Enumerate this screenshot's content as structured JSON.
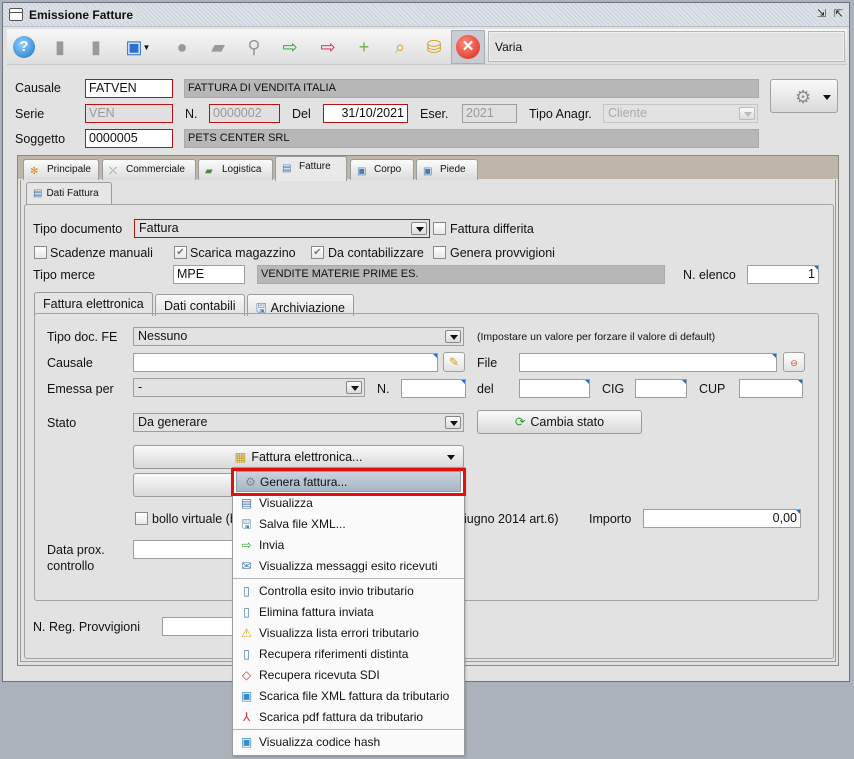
{
  "window": {
    "title": "Emissione Fatture",
    "controls": [
      "restore-icon",
      "maximize-icon"
    ]
  },
  "toolbar": {
    "tools": [
      {
        "name": "help-icon",
        "glyph": "?"
      },
      {
        "name": "edit-document-icon",
        "glyph": "▮"
      },
      {
        "name": "new-document-icon",
        "glyph": "▮"
      },
      {
        "name": "save-icon",
        "glyph": "💾"
      },
      {
        "name": "delete-icon",
        "glyph": "●"
      },
      {
        "name": "print-icon",
        "glyph": "▰"
      },
      {
        "name": "search-icon",
        "glyph": "⚲"
      },
      {
        "name": "import-icon",
        "glyph": "⇨"
      },
      {
        "name": "export-icon",
        "glyph": "⇨"
      },
      {
        "name": "add-document-icon",
        "glyph": "+"
      },
      {
        "name": "find-icon",
        "glyph": "🔍"
      },
      {
        "name": "coins-icon",
        "glyph": "⛁"
      }
    ],
    "close_label": "✕",
    "status_text": "Varia"
  },
  "header": {
    "causale_label": "Causale",
    "causale_value": "FATVEN",
    "causale_desc": "FATTURA DI VENDITA ITALIA",
    "serie_label": "Serie",
    "serie_value": "VEN",
    "numero_label": "N.",
    "numero_value": "0000002",
    "del_label": "Del",
    "del_value": "31/10/2021",
    "eser_label": "Eser.",
    "eser_value": "2021",
    "tipo_anagr_label": "Tipo Anagr.",
    "tipo_anagr_value": "Cliente",
    "soggetto_label": "Soggetto",
    "soggetto_value": "0000005",
    "soggetto_desc": "PETS CENTER SRL"
  },
  "tabs": [
    {
      "label": "Principale",
      "icon": "✻"
    },
    {
      "label": "Commerciale",
      "icon": "⤬"
    },
    {
      "label": "Logistica",
      "icon": "▰"
    },
    {
      "label": "Fatture",
      "icon": "▤",
      "active": true
    },
    {
      "label": "Corpo",
      "icon": "▣"
    },
    {
      "label": "Piede",
      "icon": "▣"
    }
  ],
  "subtab": {
    "label": "Dati Fattura"
  },
  "dati_fattura": {
    "tipo_documento_label": "Tipo documento",
    "tipo_documento_value": "Fattura",
    "fattura_differita_label": "Fattura differita",
    "fattura_differita_checked": false,
    "scadenze_manuali_label": "Scadenze manuali",
    "scadenze_manuali_checked": false,
    "scarica_magazzino_label": "Scarica magazzino",
    "scarica_magazzino_checked": true,
    "da_contabilizzare_label": "Da contabilizzare",
    "da_contabilizzare_checked": true,
    "genera_provvigioni_label": "Genera provvigioni",
    "genera_provvigioni_checked": false,
    "tipo_merce_label": "Tipo merce",
    "tipo_merce_value": "MPE",
    "tipo_merce_desc": "VENDITE MATERIE PRIME ES.",
    "n_elenco_label": "N. elenco",
    "n_elenco_value": "1",
    "n_reg_provvigioni_label": "N. Reg. Provvigioni",
    "n_reg_provvigioni_value": ""
  },
  "inner_tabs": [
    {
      "label": "Fattura elettronica",
      "active": true
    },
    {
      "label": "Dati contabili"
    },
    {
      "label": "Archiviazione"
    }
  ],
  "fe": {
    "tipo_doc_label": "Tipo doc. FE",
    "tipo_doc_value": "Nessuno",
    "tipo_doc_hint": "(Impostare un valore per forzare il valore di default)",
    "causale_label": "Causale",
    "causale_value": "",
    "file_label": "File",
    "file_value": "",
    "emessa_per_label": "Emessa per",
    "emessa_per_value": "-",
    "n_label": "N.",
    "n_value": "",
    "del_label": "del",
    "del_value": "",
    "cig_label": "CIG",
    "cig_value": "",
    "cup_label": "CUP",
    "cup_value": "",
    "stato_label": "Stato",
    "stato_value": "Da generare",
    "cambia_stato_label": "Cambia stato",
    "fattura_elettronica_button": "Fattura elettronica...",
    "bollo_label": "bollo virtuale (b",
    "bollo_suffix": "iugno 2014 art.6)",
    "bollo_checked": false,
    "importo_label": "Importo",
    "importo_value": "0,00",
    "data_prox_label_1": "Data prox.",
    "data_prox_label_2": "controllo",
    "data_prox_value": ""
  },
  "menu": {
    "items": [
      {
        "label": "Genera fattura...",
        "icon": "⚙",
        "selected": true
      },
      {
        "label": "Visualizza",
        "icon": "▤"
      },
      {
        "label": "Salva file XML...",
        "icon": "🖫"
      },
      {
        "label": "Invia",
        "icon": "⇨"
      },
      {
        "label": "Visualizza messaggi esito ricevuti",
        "icon": "✉"
      },
      {
        "label": "Controlla esito invio tributario",
        "icon": "▯"
      },
      {
        "label": "Elimina fattura inviata",
        "icon": "▯"
      },
      {
        "label": "Visualizza lista errori tributario",
        "icon": "⚠"
      },
      {
        "label": "Recupera riferimenti distinta",
        "icon": "▯"
      },
      {
        "label": "Recupera ricevuta SDI",
        "icon": "◇"
      },
      {
        "label": "Scarica file XML fattura da tributario",
        "icon": "▣"
      },
      {
        "label": "Scarica pdf fattura da tributario",
        "icon": "⅄"
      },
      {
        "label": "Visualizza codice hash",
        "icon": "▣"
      }
    ]
  }
}
